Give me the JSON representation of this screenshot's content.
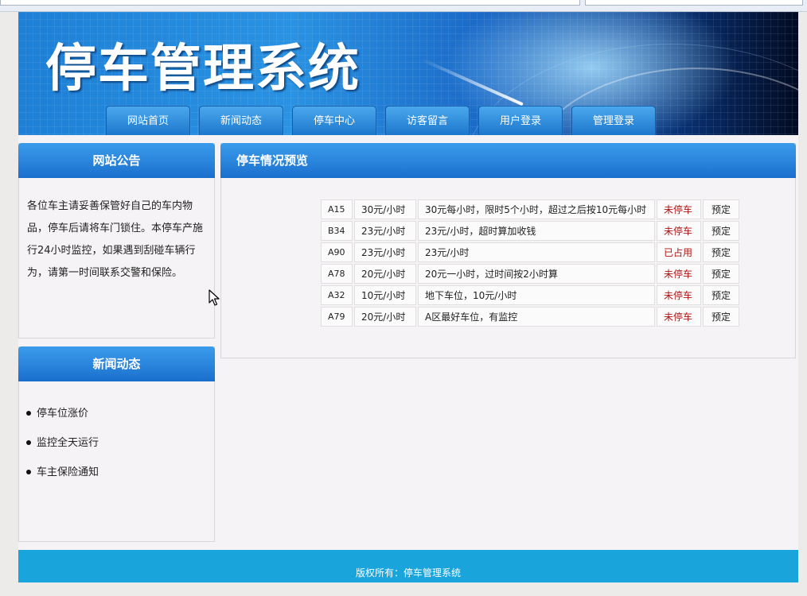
{
  "site": {
    "title": "停车管理系统",
    "nav": [
      "网站首页",
      "新闻动态",
      "停车中心",
      "访客留言",
      "用户登录",
      "管理登录"
    ]
  },
  "notice": {
    "title": "网站公告",
    "text": "各位车主请妥善保管好自己的车内物品，停车后请将车门锁住。本停车产施行24小时监控，如果遇到刮碰车辆行为，请第一时间联系交警和保险。"
  },
  "news": {
    "title": "新闻动态",
    "items": [
      "停车位涨价",
      "监控全天运行",
      "车主保险通知"
    ]
  },
  "parking": {
    "title": "停车情况预览",
    "rows": [
      {
        "code": "A15",
        "price": "30元/小时",
        "desc": "30元每小时，限时5个小时，超过之后按10元每小时",
        "status": "未停车",
        "action": "预定"
      },
      {
        "code": "B34",
        "price": "23元/小时",
        "desc": "23元/小时，超时算加收钱",
        "status": "未停车",
        "action": "预定"
      },
      {
        "code": "A90",
        "price": "23元/小时",
        "desc": "23元/小时",
        "status": "已占用",
        "action": "预定"
      },
      {
        "code": "A78",
        "price": "20元/小时",
        "desc": "20元一小时，过时间按2小时算",
        "status": "未停车",
        "action": "预定"
      },
      {
        "code": "A32",
        "price": "10元/小时",
        "desc": "地下车位，10元/小时",
        "status": "未停车",
        "action": "预定"
      },
      {
        "code": "A79",
        "price": "20元/小时",
        "desc": "A区最好车位，有监控",
        "status": "未停车",
        "action": "预定"
      }
    ]
  },
  "footer": {
    "text": "版权所有：停车管理系统"
  },
  "colors": {
    "accent": "#1a6fcd",
    "footer": "#1aa4dc",
    "status": "#b01515"
  }
}
